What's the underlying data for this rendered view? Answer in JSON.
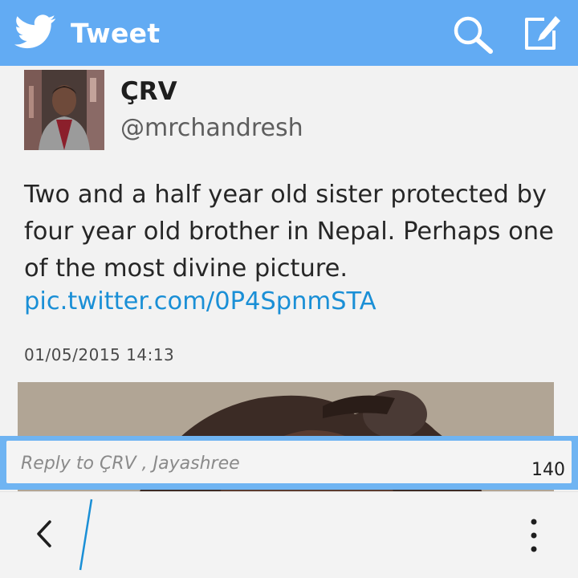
{
  "header": {
    "logo_icon": "twitter-bird-icon",
    "title": "Tweet",
    "search_icon": "search-icon",
    "compose_icon": "compose-icon",
    "background_color": "#62abf3"
  },
  "tweet": {
    "author_name": "ÇRV",
    "author_handle": "@mrchandresh",
    "text": "Two and a half year old sister protected by four year old brother in Nepal. Perhaps one of the most divine picture.",
    "link": "pic.twitter.com/0P4SpnmSTA",
    "timestamp": "01/05/2015 14:13",
    "link_color": "#1a8fd6"
  },
  "reply": {
    "placeholder": "Reply to ÇRV , Jayashree",
    "char_count": "140"
  },
  "action_bar": {
    "back_icon": "chevron-left-icon",
    "menu_icon": "overflow-menu-icon"
  }
}
